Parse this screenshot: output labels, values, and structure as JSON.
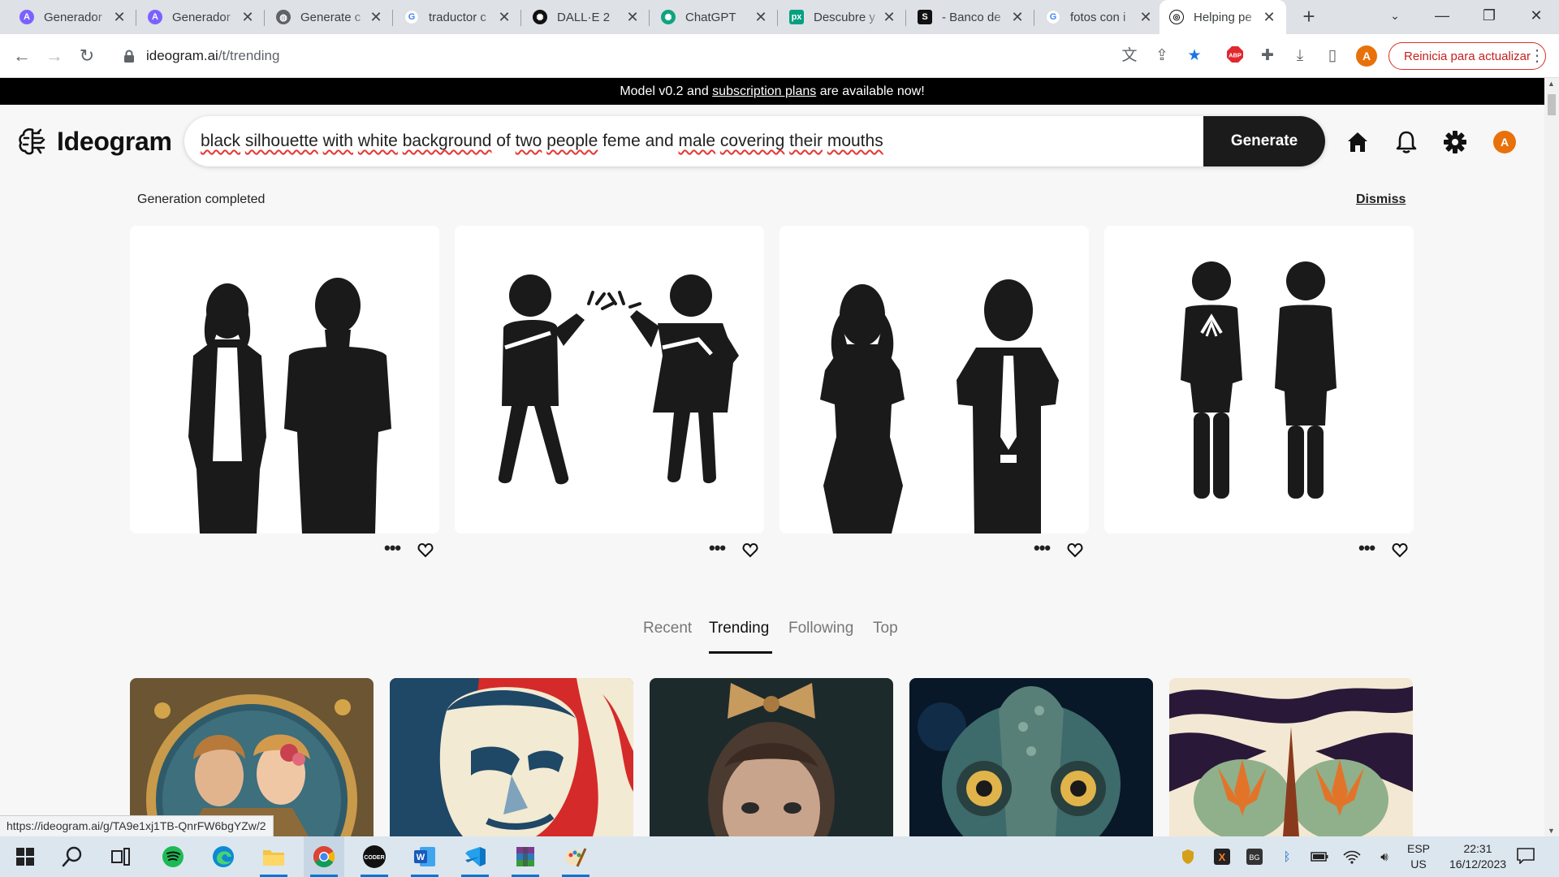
{
  "browser": {
    "tabs": [
      {
        "title": "Generador",
        "icon": "ideogram-a-icon",
        "color": "#7b61ff"
      },
      {
        "title": "Generador",
        "icon": "ideogram-a-icon",
        "color": "#7b61ff"
      },
      {
        "title": "Generate c",
        "icon": "globe-icon",
        "color": "#5f6368"
      },
      {
        "title": "traductor c",
        "icon": "google-icon",
        "color": "#4285f4"
      },
      {
        "title": "DALL·E 2",
        "icon": "openai-icon",
        "color": "#111111"
      },
      {
        "title": "ChatGPT",
        "icon": "openai-icon",
        "color": "#10a37f"
      },
      {
        "title": "Descubre y",
        "icon": "pexels-icon",
        "color": "#05a081"
      },
      {
        "title": "- Banco de",
        "icon": "shutterstock-icon",
        "color": "#111111"
      },
      {
        "title": "fotos con i",
        "icon": "google-icon",
        "color": "#4285f4"
      },
      {
        "title": "Helping pe",
        "icon": "ideogram-logo-icon",
        "color": "#111111"
      }
    ],
    "url_domain": "ideogram.ai",
    "url_path": "/t/trending",
    "update_button": "Reinicia para actualizar",
    "profile_initial": "A",
    "status_url": "https://ideogram.ai/g/TA9e1xj1TB-QnrFW6bgYZw/2"
  },
  "banner": {
    "prefix": "Model v0.2 and",
    "link": "subscription plans",
    "suffix": "are available now!"
  },
  "header": {
    "logo_text": "Ideogram",
    "prompt_words": [
      "black",
      "silhouette",
      "with",
      "white",
      "background",
      "of",
      "two",
      "people",
      "feme",
      "and",
      "male",
      "covering",
      "their",
      "mouths"
    ],
    "spellcheck_flagged": [
      0,
      1,
      2,
      3,
      4,
      6,
      7,
      10,
      11,
      12,
      13
    ],
    "generate_label": "Generate",
    "avatar_initial": "A",
    "accent_color": "#e8710a"
  },
  "generation": {
    "status": "Generation completed",
    "dismiss": "Dismiss",
    "results": [
      {
        "subject": "man and woman silhouettes standing"
      },
      {
        "subject": "two stick figures with hands to mouth"
      },
      {
        "subject": "woman and man covering faces"
      },
      {
        "subject": "two pictogram figures hands over mouth"
      }
    ]
  },
  "feed": {
    "tabs": [
      "Recent",
      "Trending",
      "Following",
      "Top"
    ],
    "active_tab": "Trending",
    "images": [
      {
        "subject": "art nouveau couple"
      },
      {
        "subject": "red white blue poster portrait"
      },
      {
        "subject": "girl with bow"
      },
      {
        "subject": "chameleon eyes"
      },
      {
        "subject": "orange leaf pattern"
      }
    ]
  },
  "taskbar": {
    "apps": [
      "start-icon",
      "search-icon",
      "task-view-icon",
      "spotify-icon",
      "edge-icon",
      "file-explorer-icon",
      "chrome-icon",
      "coder-icon",
      "word-icon",
      "vscode-icon",
      "winrar-icon",
      "paint-icon"
    ],
    "active_apps": [
      "file-explorer-icon",
      "chrome-icon",
      "coder-icon",
      "word-icon",
      "vscode-icon",
      "winrar-icon",
      "paint-icon"
    ],
    "lang_line1": "ESP",
    "lang_line2": "US",
    "time": "22:31",
    "date": "16/12/2023"
  }
}
